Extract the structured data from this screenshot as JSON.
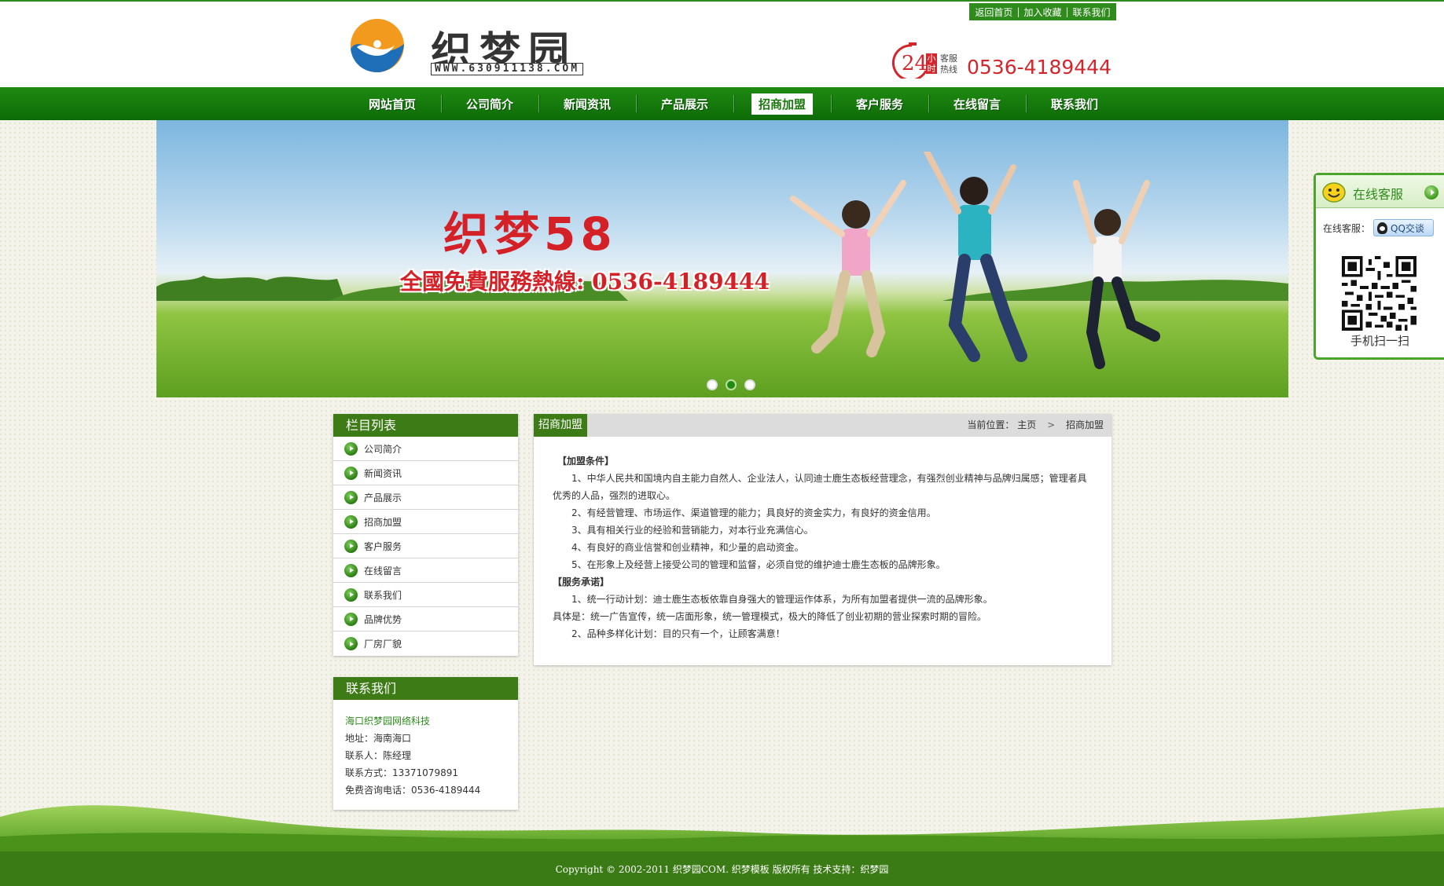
{
  "header": {
    "logo_text": "织梦园",
    "logo_url": "WWW.630911138.COM",
    "toplinks": [
      "返回首页",
      "加入收藏",
      "联系我们"
    ],
    "hotline_24": "24",
    "hotline_hours": "小时",
    "hotline_label": "客服热线",
    "hotline_number": "0536-4189444"
  },
  "nav": {
    "items": [
      "网站首页",
      "公司简介",
      "新闻资讯",
      "产品展示",
      "招商加盟",
      "客户服务",
      "在线留言",
      "联系我们"
    ],
    "active_index": 4
  },
  "banner": {
    "title": "织梦58",
    "subtitle": "全國免費服務熱線: 0536-4189444",
    "slide_count": 3,
    "active_slide": 2
  },
  "sidebar": {
    "category_title": "栏目列表",
    "categories": [
      "公司简介",
      "新闻资讯",
      "产品展示",
      "招商加盟",
      "客户服务",
      "在线留言",
      "联系我们",
      "品牌优势",
      "厂房厂貌"
    ],
    "contact_title": "联系我们",
    "contact": {
      "company": "海口织梦园网络科技",
      "address": "地址：海南海口",
      "person": "联系人：陈经理",
      "phone": "联系方式：13371079891",
      "free_hotline": "免费咨询电话：0536-4189444"
    }
  },
  "main": {
    "tab_label": "招商加盟",
    "breadcrumb_label": "当前位置：",
    "breadcrumb_home": "主页",
    "breadcrumb_current": "招商加盟",
    "paragraphs": {
      "p1": "【加盟条件】",
      "p2": "1、中华人民共和国境内自主能力自然人、企业法人，认同迪士鹿生态板经营理念，有强烈创业精神与品牌归属感；管理者具优秀的人品，强烈的进取心。",
      "p3": "2、有经营管理、市场运作、渠道管理的能力；具良好的资金实力，有良好的资金信用。",
      "p4": "3、具有相关行业的经验和营销能力，对本行业充满信心。",
      "p5": "4、有良好的商业信誉和创业精神，和少量的启动资金。",
      "p6": "5、在形象上及经营上接受公司的管理和监督，必须自觉的维护迪士鹿生态板的品牌形象。",
      "p7": "【服务承诺】",
      "p8": "1、统一行动计划：迪士鹿生态板依靠自身强大的管理运作体系，为所有加盟者提供一流的品牌形象。",
      "p9": "具体是：统一广告宣传，统一店面形象，统一管理模式，极大的降低了创业初期的营业探索时期的冒险。",
      "p10": "2、品种多样化计划：目的只有一个，让顾客满意！"
    }
  },
  "online_service": {
    "title": "在线客服",
    "label": "在线客服：",
    "qq_button": "QQ交谈",
    "scan_text": "手机扫一扫"
  },
  "footer": {
    "copyright": "Copyright © 2002-2011 织梦园COM. 织梦模板 版权所有  技术支持：织梦园"
  },
  "colors": {
    "brand_green": "#2e8b1c",
    "dark_green": "#3d7b17",
    "hotline_red": "#d3262c"
  }
}
